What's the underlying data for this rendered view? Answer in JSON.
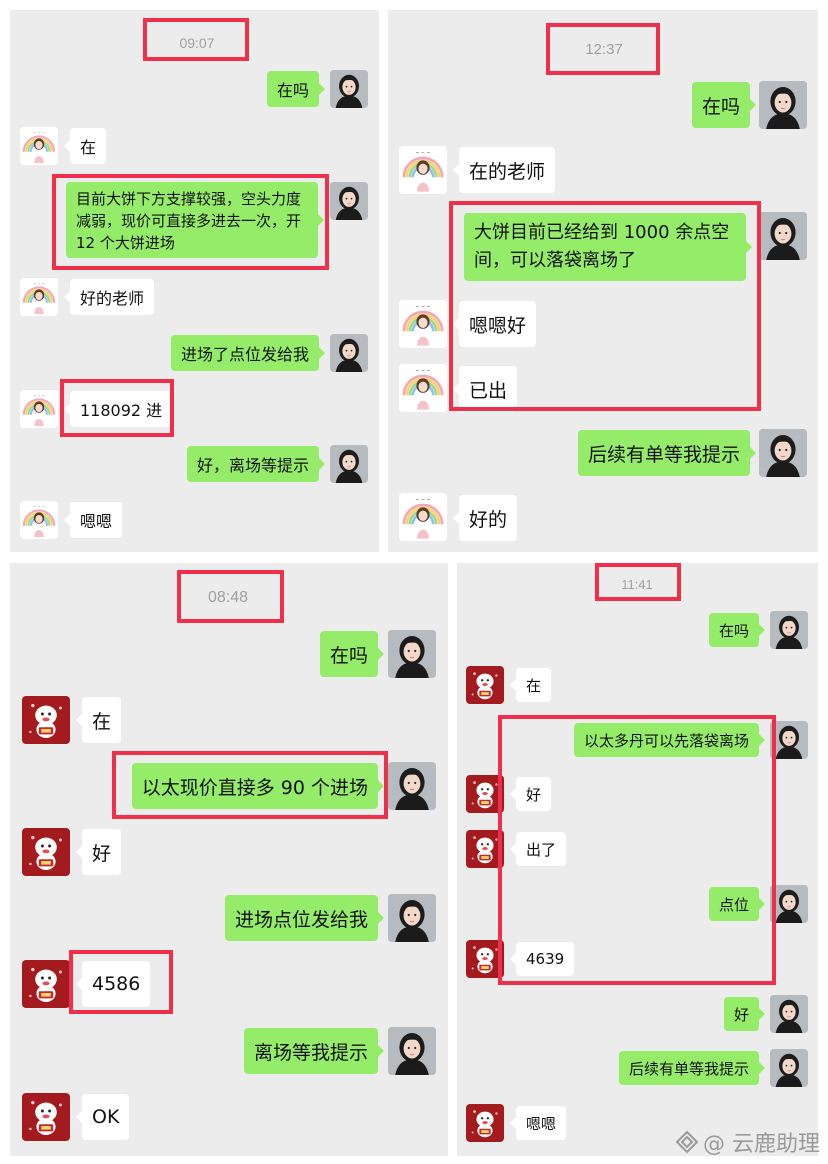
{
  "panels": {
    "p1": {
      "timestamp": "09:07",
      "messages": [
        {
          "from": "me",
          "text": "在吗"
        },
        {
          "from": "them",
          "text": "在"
        },
        {
          "from": "me",
          "text": "目前大饼下方支撑较强，空头力度减弱，现价可直接多进去一次，开 12 个大饼进场"
        },
        {
          "from": "them",
          "text": "好的老师"
        },
        {
          "from": "me",
          "text": "进场了点位发给我"
        },
        {
          "from": "them",
          "text": "118092 进"
        },
        {
          "from": "me",
          "text": "好，离场等提示"
        },
        {
          "from": "them",
          "text": "嗯嗯"
        }
      ]
    },
    "p2": {
      "timestamp": "12:37",
      "messages": [
        {
          "from": "me",
          "text": "在吗"
        },
        {
          "from": "them",
          "text": "在的老师"
        },
        {
          "from": "me",
          "text": "大饼目前已经给到 1000 余点空间，可以落袋离场了"
        },
        {
          "from": "them",
          "text": "嗯嗯好"
        },
        {
          "from": "them",
          "text": "已出"
        },
        {
          "from": "me",
          "text": "后续有单等我提示"
        },
        {
          "from": "them",
          "text": "好的"
        }
      ]
    },
    "p3": {
      "timestamp": "08:48",
      "messages": [
        {
          "from": "me",
          "text": "在吗"
        },
        {
          "from": "them",
          "text": "在"
        },
        {
          "from": "me",
          "text": "以太现价直接多 90 个进场"
        },
        {
          "from": "them",
          "text": "好"
        },
        {
          "from": "me",
          "text": "进场点位发给我"
        },
        {
          "from": "them",
          "text": "4586"
        },
        {
          "from": "me",
          "text": "离场等我提示"
        },
        {
          "from": "them",
          "text": "OK"
        }
      ]
    },
    "p4": {
      "timestamp": "11:41",
      "messages": [
        {
          "from": "me",
          "text": "在吗"
        },
        {
          "from": "them",
          "text": "在"
        },
        {
          "from": "me",
          "text": "以太多丹可以先落袋离场"
        },
        {
          "from": "them",
          "text": "好"
        },
        {
          "from": "them",
          "text": "出了"
        },
        {
          "from": "me",
          "text": "点位"
        },
        {
          "from": "them",
          "text": "4639"
        },
        {
          "from": "me",
          "text": "好"
        },
        {
          "from": "me",
          "text": "后续有单等我提示"
        },
        {
          "from": "them",
          "text": "嗯嗯"
        }
      ]
    }
  },
  "avatars": {
    "me": "woman-portrait-avatar",
    "them_p1p2": "rainbow-girl-avatar",
    "them_p3p4": "red-cartoon-avatar"
  },
  "colors": {
    "my_bubble": "#95ec69",
    "their_bubble": "#ffffff",
    "panel_bg": "#ececec",
    "highlight_box": "#f0304a"
  },
  "watermark": "@ 云鹿助理"
}
